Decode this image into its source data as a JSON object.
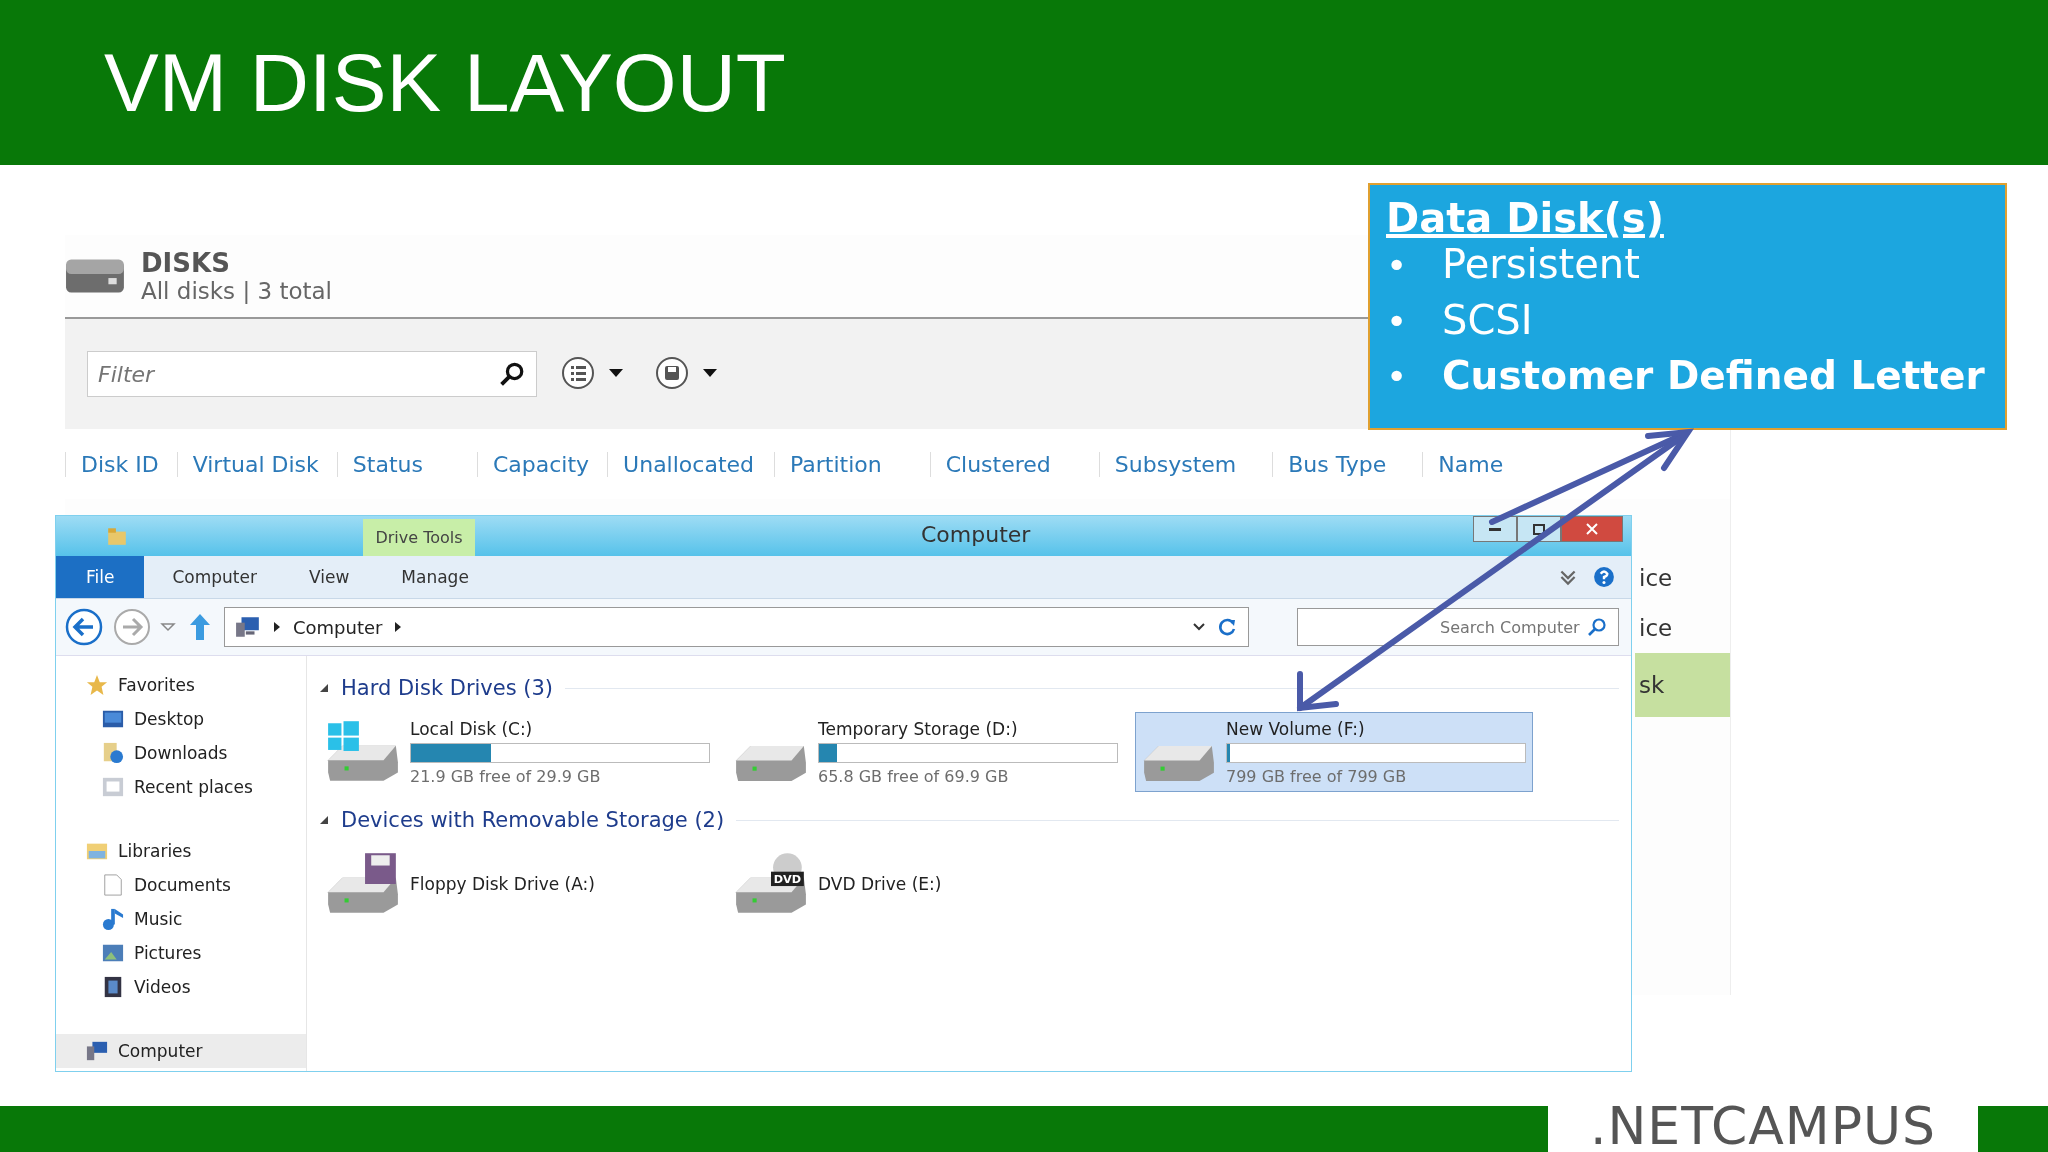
{
  "slide": {
    "title": "VM DISK LAYOUT",
    "logo": ".NETCAMPUS"
  },
  "server_manager": {
    "heading": "DISKS",
    "subheading": "All disks | 3 total",
    "filter": {
      "placeholder": "Filter"
    },
    "columns": [
      "Disk ID",
      "Virtual Disk",
      "Status",
      "Capacity",
      "Unallocated",
      "Partition",
      "Clustered",
      "Subsystem",
      "Bus Type",
      "Name"
    ],
    "rows": [
      {
        "cell": "ice",
        "selected": false
      },
      {
        "cell": "ice",
        "selected": false
      },
      {
        "cell": "sk",
        "selected": true
      }
    ]
  },
  "explorer": {
    "title": "Computer",
    "context_tab": "Drive Tools",
    "ribbon_tabs": [
      {
        "label": "File",
        "selected": true
      },
      {
        "label": "Computer",
        "selected": false
      },
      {
        "label": "View",
        "selected": false
      },
      {
        "label": "Manage",
        "selected": false
      }
    ],
    "address": [
      "Computer"
    ],
    "search": {
      "placeholder": "Search Computer"
    },
    "sidebar": [
      {
        "label": "Favorites",
        "selected": false,
        "children": [
          {
            "label": "Desktop",
            "selected": false
          },
          {
            "label": "Downloads",
            "selected": false
          },
          {
            "label": "Recent places",
            "selected": false
          }
        ]
      },
      {
        "label": "Libraries",
        "selected": false,
        "children": [
          {
            "label": "Documents",
            "selected": false
          },
          {
            "label": "Music",
            "selected": false
          },
          {
            "label": "Pictures",
            "selected": false
          },
          {
            "label": "Videos",
            "selected": false
          }
        ]
      },
      {
        "label": "Computer",
        "selected": true
      }
    ],
    "groups": [
      {
        "title": "Hard Disk Drives (3)",
        "drives": [
          {
            "kind": "system",
            "name": "Local Disk (C:)",
            "level": 0.27,
            "free": "21.9 GB free of 29.9 GB",
            "selected": false
          },
          {
            "kind": "hdd",
            "name": "Temporary Storage (D:)",
            "level": 0.06,
            "free": "65.8 GB free of 69.9 GB",
            "selected": false
          },
          {
            "kind": "hdd",
            "name": "New Volume (F:)",
            "level": 0.01,
            "free": "799 GB free of 799 GB",
            "selected": true
          }
        ]
      },
      {
        "title": "Devices with Removable Storage (2)",
        "drives": [
          {
            "kind": "floppy",
            "name": "Floppy Disk Drive (A:)",
            "selected": false
          },
          {
            "kind": "dvd",
            "name": "DVD Drive (E:)",
            "badge": "DVD",
            "selected": false
          }
        ]
      }
    ]
  },
  "callout": {
    "heading": "Data Disk(s)",
    "items": [
      {
        "bullet": "•",
        "text": "Persistent",
        "bold": false
      },
      {
        "bullet": "•",
        "text": "SCSI",
        "bold": false
      },
      {
        "bullet": "•",
        "text": "Customer Defined Letter",
        "bold": true
      }
    ]
  }
}
